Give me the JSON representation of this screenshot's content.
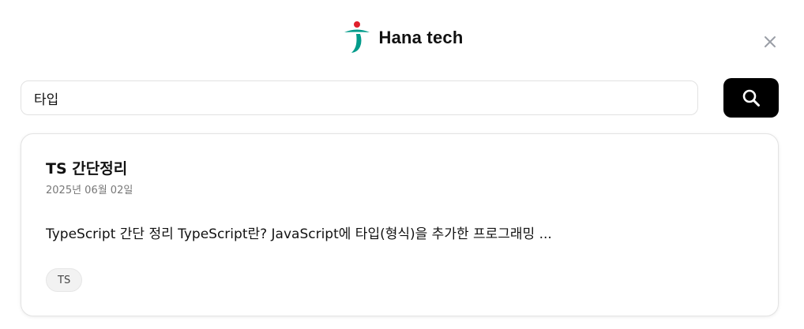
{
  "header": {
    "brand_name": "Hana tech",
    "logo_icon": "hana-logo-icon",
    "close_icon": "close-icon"
  },
  "search": {
    "value": "타입",
    "button_icon": "search-icon"
  },
  "results": [
    {
      "title": "TS 간단정리",
      "date": "2025년 06월 02일",
      "excerpt": "TypeScript 간단 정리 TypeScript란? JavaScript에 타입(형식)을 추가한 프로그래밍 ...",
      "tags": [
        "TS"
      ]
    }
  ],
  "colors": {
    "brand_green": "#009b8a",
    "brand_red": "#e0202b",
    "button_bg": "#000000",
    "close_gray": "#9a9ea6"
  }
}
